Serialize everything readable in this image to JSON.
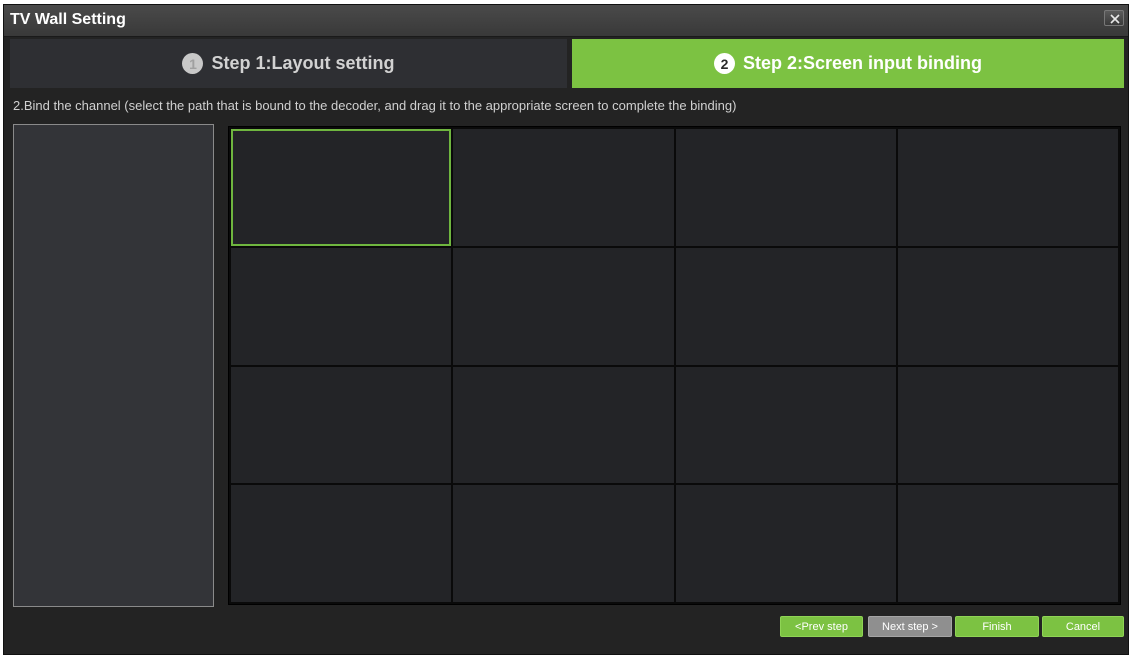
{
  "window": {
    "title": "TV Wall Setting",
    "close_icon": "close-icon"
  },
  "steps": [
    {
      "number": "1",
      "label": "Step 1:Layout setting",
      "active": false
    },
    {
      "number": "2",
      "label": "Step 2:Screen input binding",
      "active": true
    }
  ],
  "instruction": "2.Bind the channel (select the path that is bound to the decoder, and drag it to the appropriate screen to complete the binding)",
  "channel_list": {
    "items": []
  },
  "screen_grid": {
    "rows": 4,
    "columns": 4,
    "selected_index": 0
  },
  "buttons": {
    "prev": "<Prev step",
    "next": "Next step >",
    "finish": "Finish",
    "cancel": "Cancel"
  },
  "colors": {
    "accent_green": "#7cc242",
    "selected_border": "#6fb63f",
    "disabled_gray": "#8f8f8f"
  }
}
